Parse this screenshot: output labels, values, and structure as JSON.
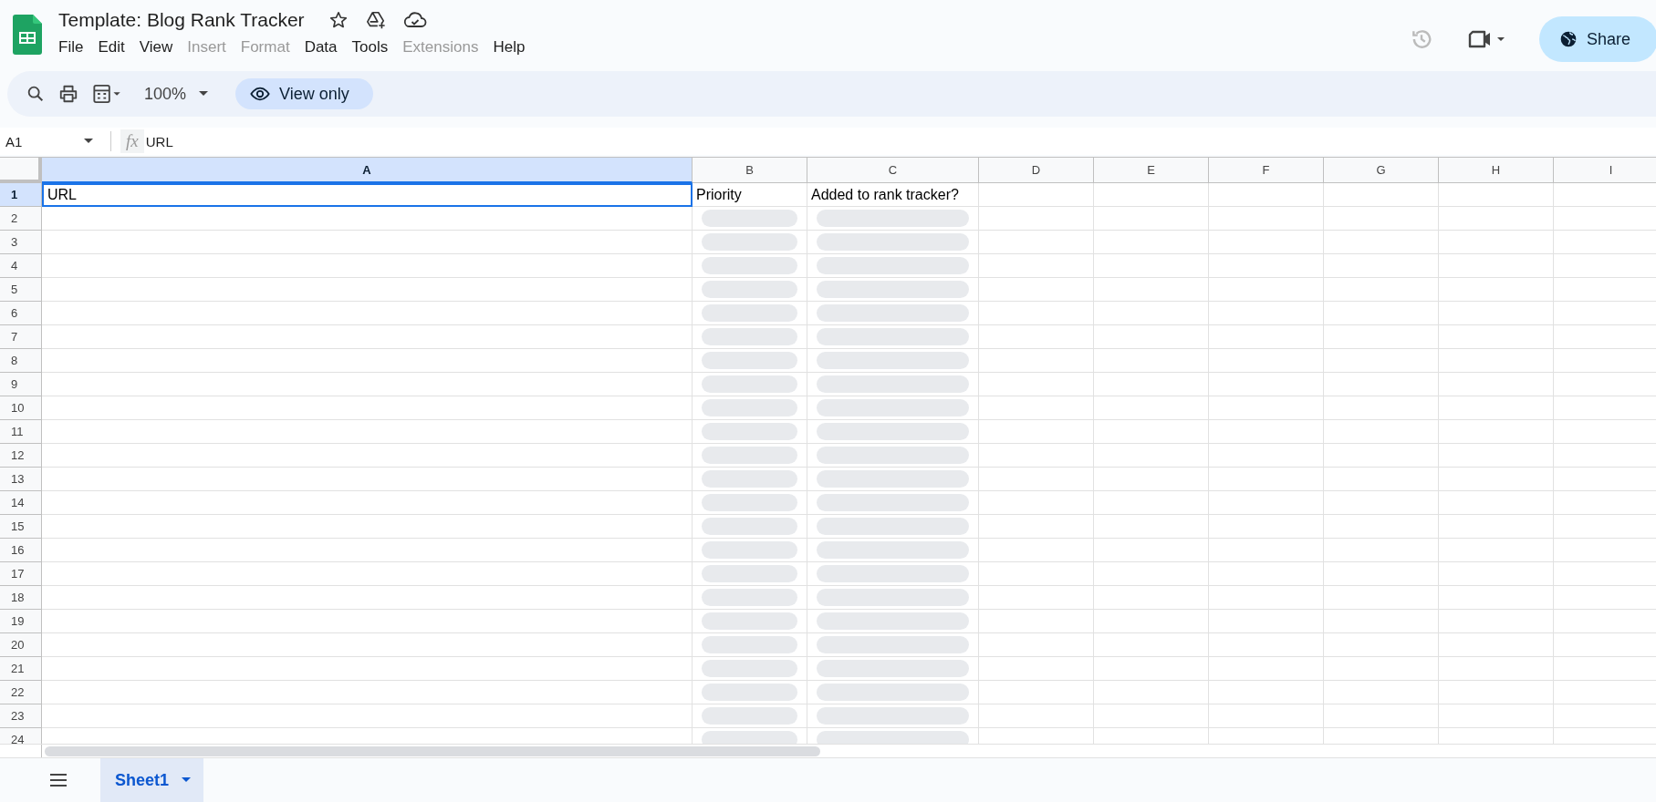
{
  "document": {
    "title": "Template: Blog Rank Tracker"
  },
  "menu": [
    {
      "label": "File",
      "disabled": false
    },
    {
      "label": "Edit",
      "disabled": false
    },
    {
      "label": "View",
      "disabled": false
    },
    {
      "label": "Insert",
      "disabled": true
    },
    {
      "label": "Format",
      "disabled": true
    },
    {
      "label": "Data",
      "disabled": false
    },
    {
      "label": "Tools",
      "disabled": false
    },
    {
      "label": "Extensions",
      "disabled": true
    },
    {
      "label": "Help",
      "disabled": false
    }
  ],
  "share_button": {
    "label": "Share"
  },
  "toolbar": {
    "zoom": "100%",
    "mode_chip": "View only"
  },
  "formula_bar": {
    "cell_ref": "A1",
    "fx_label": "fx",
    "value": "URL"
  },
  "columns": [
    {
      "label": "A",
      "selected": true
    },
    {
      "label": "B",
      "selected": false
    },
    {
      "label": "C",
      "selected": false
    },
    {
      "label": "D",
      "selected": false
    },
    {
      "label": "E",
      "selected": false
    },
    {
      "label": "F",
      "selected": false
    },
    {
      "label": "G",
      "selected": false
    },
    {
      "label": "H",
      "selected": false
    },
    {
      "label": "I",
      "selected": false
    }
  ],
  "rows": [
    {
      "number": "1",
      "selected": true,
      "cells": [
        {
          "kind": "text",
          "text": "URL"
        },
        {
          "kind": "text",
          "text": "Priority"
        },
        {
          "kind": "text",
          "text": "Added to rank tracker?"
        }
      ]
    },
    {
      "number": "2",
      "selected": false,
      "cells": [
        {
          "kind": "empty"
        },
        {
          "kind": "chip"
        },
        {
          "kind": "chip"
        }
      ]
    },
    {
      "number": "3",
      "selected": false,
      "cells": [
        {
          "kind": "empty"
        },
        {
          "kind": "chip"
        },
        {
          "kind": "chip"
        }
      ]
    },
    {
      "number": "4",
      "selected": false,
      "cells": [
        {
          "kind": "empty"
        },
        {
          "kind": "chip"
        },
        {
          "kind": "chip"
        }
      ]
    },
    {
      "number": "5",
      "selected": false,
      "cells": [
        {
          "kind": "empty"
        },
        {
          "kind": "chip"
        },
        {
          "kind": "chip"
        }
      ]
    },
    {
      "number": "6",
      "selected": false,
      "cells": [
        {
          "kind": "empty"
        },
        {
          "kind": "chip"
        },
        {
          "kind": "chip"
        }
      ]
    },
    {
      "number": "7",
      "selected": false,
      "cells": [
        {
          "kind": "empty"
        },
        {
          "kind": "chip"
        },
        {
          "kind": "chip"
        }
      ]
    },
    {
      "number": "8",
      "selected": false,
      "cells": [
        {
          "kind": "empty"
        },
        {
          "kind": "chip"
        },
        {
          "kind": "chip"
        }
      ]
    },
    {
      "number": "9",
      "selected": false,
      "cells": [
        {
          "kind": "empty"
        },
        {
          "kind": "chip"
        },
        {
          "kind": "chip"
        }
      ]
    },
    {
      "number": "10",
      "selected": false,
      "cells": [
        {
          "kind": "empty"
        },
        {
          "kind": "chip"
        },
        {
          "kind": "chip"
        }
      ]
    },
    {
      "number": "11",
      "selected": false,
      "cells": [
        {
          "kind": "empty"
        },
        {
          "kind": "chip"
        },
        {
          "kind": "chip"
        }
      ]
    },
    {
      "number": "12",
      "selected": false,
      "cells": [
        {
          "kind": "empty"
        },
        {
          "kind": "chip"
        },
        {
          "kind": "chip"
        }
      ]
    },
    {
      "number": "13",
      "selected": false,
      "cells": [
        {
          "kind": "empty"
        },
        {
          "kind": "chip"
        },
        {
          "kind": "chip"
        }
      ]
    },
    {
      "number": "14",
      "selected": false,
      "cells": [
        {
          "kind": "empty"
        },
        {
          "kind": "chip"
        },
        {
          "kind": "chip"
        }
      ]
    },
    {
      "number": "15",
      "selected": false,
      "cells": [
        {
          "kind": "empty"
        },
        {
          "kind": "chip"
        },
        {
          "kind": "chip"
        }
      ]
    },
    {
      "number": "16",
      "selected": false,
      "cells": [
        {
          "kind": "empty"
        },
        {
          "kind": "chip"
        },
        {
          "kind": "chip"
        }
      ]
    },
    {
      "number": "17",
      "selected": false,
      "cells": [
        {
          "kind": "empty"
        },
        {
          "kind": "chip"
        },
        {
          "kind": "chip"
        }
      ]
    },
    {
      "number": "18",
      "selected": false,
      "cells": [
        {
          "kind": "empty"
        },
        {
          "kind": "chip"
        },
        {
          "kind": "chip"
        }
      ]
    },
    {
      "number": "19",
      "selected": false,
      "cells": [
        {
          "kind": "empty"
        },
        {
          "kind": "chip"
        },
        {
          "kind": "chip"
        }
      ]
    },
    {
      "number": "20",
      "selected": false,
      "cells": [
        {
          "kind": "empty"
        },
        {
          "kind": "chip"
        },
        {
          "kind": "chip"
        }
      ]
    },
    {
      "number": "21",
      "selected": false,
      "cells": [
        {
          "kind": "empty"
        },
        {
          "kind": "chip"
        },
        {
          "kind": "chip"
        }
      ]
    },
    {
      "number": "22",
      "selected": false,
      "cells": [
        {
          "kind": "empty"
        },
        {
          "kind": "chip"
        },
        {
          "kind": "chip"
        }
      ]
    },
    {
      "number": "23",
      "selected": false,
      "cells": [
        {
          "kind": "empty"
        },
        {
          "kind": "chip"
        },
        {
          "kind": "chip"
        }
      ]
    },
    {
      "number": "24",
      "selected": false,
      "cells": [
        {
          "kind": "empty"
        },
        {
          "kind": "chip"
        },
        {
          "kind": "chip"
        }
      ]
    }
  ],
  "sheet_tabs": [
    {
      "label": "Sheet1",
      "selected": true
    }
  ]
}
